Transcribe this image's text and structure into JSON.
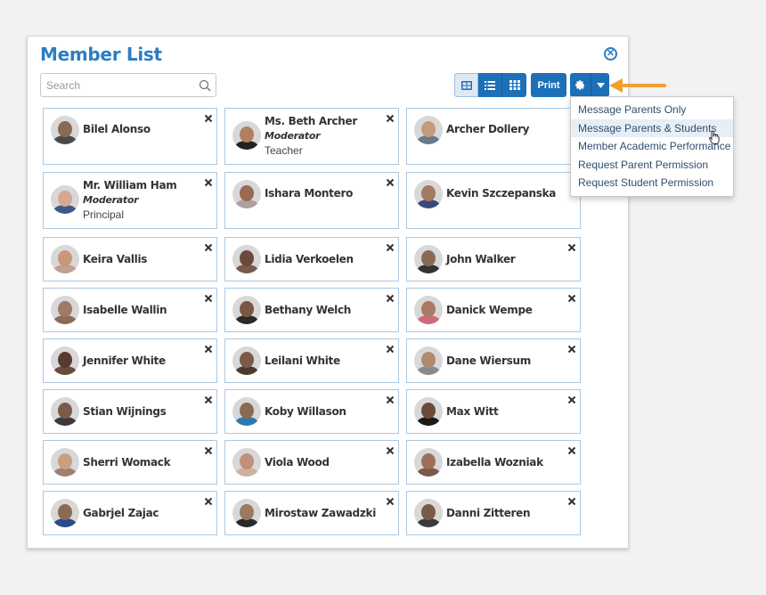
{
  "panel": {
    "title": "Member List",
    "close_icon": "close-circle-icon"
  },
  "search": {
    "placeholder": "Search",
    "value": ""
  },
  "toolbar": {
    "view_modes": [
      {
        "name": "card-view",
        "icon": "card-grid-icon",
        "active": true
      },
      {
        "name": "list-view",
        "icon": "list-icon",
        "active": false
      },
      {
        "name": "grid-view",
        "icon": "grid-icon",
        "active": false
      }
    ],
    "print_label": "Print",
    "settings_icon": "gear-icon",
    "dropdown_icon": "caret-down-icon"
  },
  "dropdown": {
    "items": [
      "Message Parents Only",
      "Message Parents & Students",
      "Member Academic Performance",
      "Request Parent Permission",
      "Request Student Permission"
    ],
    "hovered_index": 1
  },
  "members": [
    {
      "name": "Bilel Alonso",
      "role": "",
      "title": "",
      "removable": true,
      "skin": "#8a6a52",
      "shirt": "#4a4a4a"
    },
    {
      "name": "Ms. Beth Archer",
      "role": "Moderator",
      "title": "Teacher",
      "removable": true,
      "skin": "#b08060",
      "shirt": "#222222"
    },
    {
      "name": "Archer Dollery",
      "role": "",
      "title": "",
      "removable": false,
      "skin": "#c49a7c",
      "shirt": "#6a7a8a"
    },
    {
      "name": "Mr. William Ham",
      "role": "Moderator",
      "title": "Principal",
      "removable": true,
      "skin": "#d6a890",
      "shirt": "#3a5a8a"
    },
    {
      "name": "Ishara Montero",
      "role": "",
      "title": "",
      "removable": true,
      "skin": "#9a6a54",
      "shirt": "#b0a0a0"
    },
    {
      "name": "Kevin Szczepanska",
      "role": "",
      "title": "",
      "removable": false,
      "skin": "#a27a60",
      "shirt": "#3a4a7a"
    },
    {
      "name": "Keira Vallis",
      "role": "",
      "title": "",
      "removable": true,
      "skin": "#c8987a",
      "shirt": "#c0a090"
    },
    {
      "name": "Lidia Verkoelen",
      "role": "",
      "title": "",
      "removable": true,
      "skin": "#6a4a3a",
      "shirt": "#7a5a4a"
    },
    {
      "name": "John Walker",
      "role": "",
      "title": "",
      "removable": true,
      "skin": "#8a6a54",
      "shirt": "#333333"
    },
    {
      "name": "Isabelle Wallin",
      "role": "",
      "title": "",
      "removable": true,
      "skin": "#a07a66",
      "shirt": "#8a6a5a"
    },
    {
      "name": "Bethany Welch",
      "role": "",
      "title": "",
      "removable": true,
      "skin": "#7a5644",
      "shirt": "#2a2a2a"
    },
    {
      "name": "Danick Wempe",
      "role": "",
      "title": "",
      "removable": true,
      "skin": "#a87a62",
      "shirt": "#d06a7a"
    },
    {
      "name": "Jennifer White",
      "role": "",
      "title": "",
      "removable": true,
      "skin": "#5a3a2e",
      "shirt": "#6a4a3a"
    },
    {
      "name": "Leilani White",
      "role": "",
      "title": "",
      "removable": true,
      "skin": "#7a5a48",
      "shirt": "#4a3a30"
    },
    {
      "name": "Dane Wiersum",
      "role": "",
      "title": "",
      "removable": true,
      "skin": "#b08a70",
      "shirt": "#8a8a8a"
    },
    {
      "name": "Stian Wijnings",
      "role": "",
      "title": "",
      "removable": true,
      "skin": "#7a5a48",
      "shirt": "#3a3a3a"
    },
    {
      "name": "Koby Willason",
      "role": "",
      "title": "",
      "removable": true,
      "skin": "#8a6a54",
      "shirt": "#2a7ab0"
    },
    {
      "name": "Max Witt",
      "role": "",
      "title": "",
      "removable": true,
      "skin": "#6a4a38",
      "shirt": "#1a1a1a"
    },
    {
      "name": "Sherri Womack",
      "role": "",
      "title": "",
      "removable": true,
      "skin": "#c8a080",
      "shirt": "#a08070"
    },
    {
      "name": "Viola Wood",
      "role": "",
      "title": "",
      "removable": true,
      "skin": "#c0907a",
      "shirt": "#d0b0a0"
    },
    {
      "name": "Izabella Wozniak",
      "role": "",
      "title": "",
      "removable": true,
      "skin": "#9a7056",
      "shirt": "#7a5a4a"
    },
    {
      "name": "Gabrjel Zajac",
      "role": "",
      "title": "",
      "removable": true,
      "skin": "#8a6a54",
      "shirt": "#2a4a8a"
    },
    {
      "name": "Mirostaw Zawadzki",
      "role": "",
      "title": "",
      "removable": true,
      "skin": "#9a7a62",
      "shirt": "#2a2a2a"
    },
    {
      "name": "Danni Zitteren",
      "role": "",
      "title": "",
      "removable": true,
      "skin": "#7a5a48",
      "shirt": "#3a3a3a"
    }
  ],
  "colors": {
    "accent": "#2c7dc4",
    "button": "#1c70b8",
    "card_border": "#aac8e2",
    "pointer_arrow": "#f0a030"
  }
}
